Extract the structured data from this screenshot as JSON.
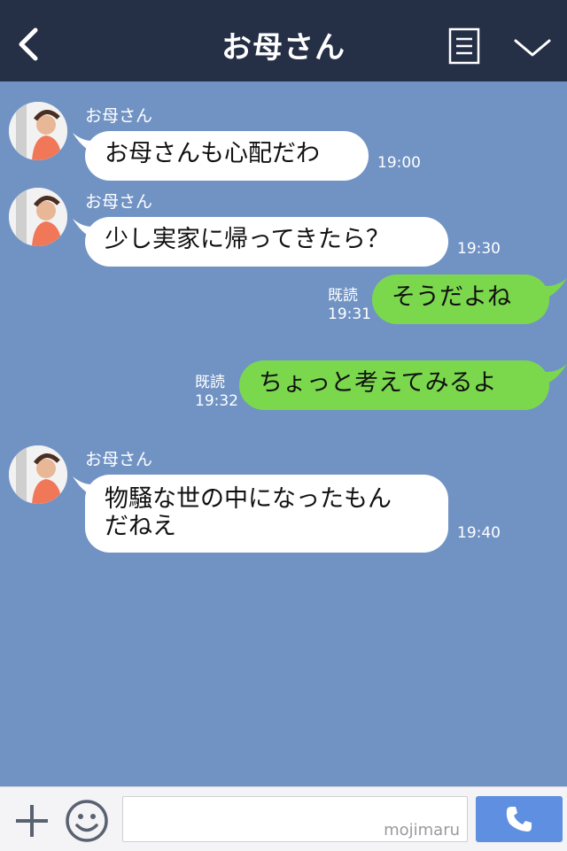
{
  "header": {
    "title": "お母さん"
  },
  "messages": [
    {
      "sender": "お母さん",
      "text": "お母さんも心配だわ",
      "time": "19:00"
    },
    {
      "sender": "お母さん",
      "text": "少し実家に帰ってきたら？",
      "time": "19:30"
    },
    {
      "text": "そうだよね",
      "read": "既読",
      "time": "19:31"
    },
    {
      "text": "ちょっと考えてみるよ",
      "read": "既読",
      "time": "19:32"
    },
    {
      "sender": "お母さん",
      "line1": "物騒な世の中になったもん",
      "line2": "だねえ",
      "time": "19:40"
    }
  ],
  "footer": {
    "watermark": "mojimaru"
  },
  "colors": {
    "background": "#7193c4",
    "header": "#252f45",
    "outgoing_bubble": "#7bd84d",
    "incoming_bubble": "#ffffff",
    "call_button": "#5e8fe0"
  }
}
